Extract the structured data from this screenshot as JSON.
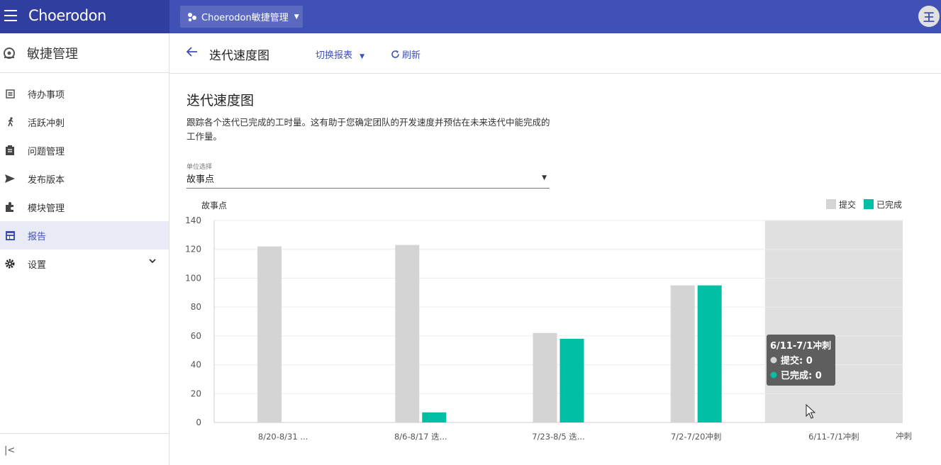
{
  "header": {
    "brand": "Choerodon",
    "project": "Choerodon敏捷管理",
    "avatar_initial": "王",
    "colors": {
      "topbar": "#3f51b5",
      "brandbar": "#303f9f",
      "accent": "#3f51b5"
    }
  },
  "sidebar": {
    "title": "敏捷管理",
    "items": [
      {
        "label": "待办事项",
        "icon": "backlog-icon"
      },
      {
        "label": "活跃冲刺",
        "icon": "run-icon"
      },
      {
        "label": "问题管理",
        "icon": "clipboard-icon"
      },
      {
        "label": "发布版本",
        "icon": "send-icon"
      },
      {
        "label": "模块管理",
        "icon": "puzzle-icon"
      },
      {
        "label": "报告",
        "icon": "report-icon",
        "active": true
      },
      {
        "label": "设置",
        "icon": "gear-icon",
        "expandable": true
      }
    ],
    "collapse": "|<"
  },
  "page": {
    "title": "迭代速度图",
    "switch_report": "切换报表",
    "refresh": "刷新"
  },
  "main": {
    "heading": "迭代速度图",
    "description": "跟踪各个迭代已完成的工时量。这有助于您确定团队的开发速度并预估在未来迭代中能完成的工作量。",
    "unit_label": "单位选择",
    "unit_value": "故事点"
  },
  "chart_data": {
    "type": "bar",
    "ylabel": "故事点",
    "ylim": [
      0,
      140
    ],
    "yticks": [
      0,
      20,
      40,
      60,
      80,
      100,
      120,
      140
    ],
    "categories": [
      "8/20-8/31 ...",
      "8/6-8/17 迭...",
      "7/23-8/5 迭...",
      "7/2-7/20冲刺",
      "6/11-7/1冲刺"
    ],
    "series": [
      {
        "name": "提交",
        "color": "#d4d4d4",
        "values": [
          122,
          123,
          62,
          95,
          0
        ]
      },
      {
        "name": "已完成",
        "color": "#00bfa5",
        "values": [
          0,
          7,
          58,
          95,
          0
        ]
      }
    ],
    "legend": "top-right",
    "grid": true,
    "highlighted_category_index": 4,
    "tooltip": {
      "title": "6/11-7/1冲刺",
      "lines": [
        "提交: 0",
        "已完成: 0"
      ]
    },
    "overflow_label": "冲刺"
  }
}
